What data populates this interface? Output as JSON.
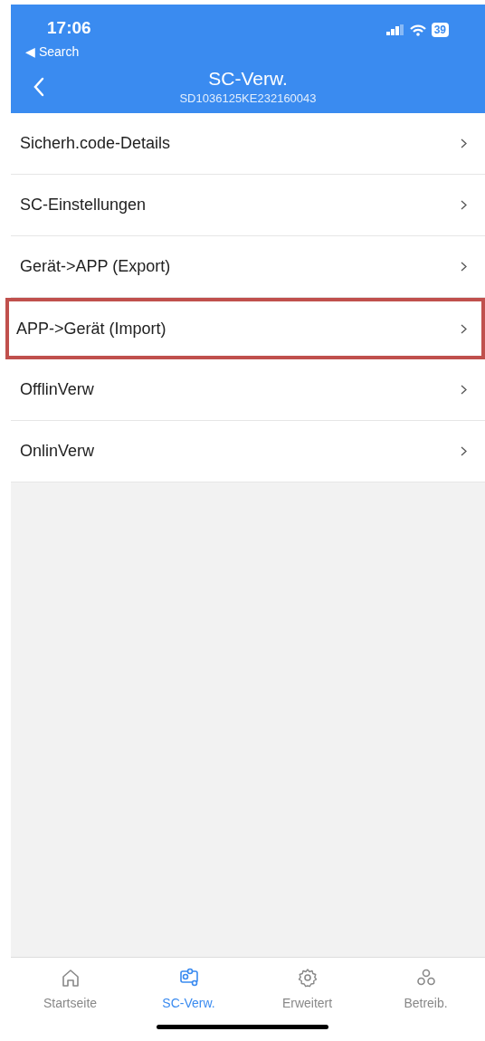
{
  "status_bar": {
    "time": "17:06",
    "back_link": "◀ Search",
    "battery": "39"
  },
  "header": {
    "title": "SC-Verw.",
    "subtitle": "SD1036125KE232160043"
  },
  "menu": [
    {
      "label": "Sicherh.code-Details",
      "highlighted": false
    },
    {
      "label": "SC-Einstellungen",
      "highlighted": false
    },
    {
      "label": "Gerät->APP (Export)",
      "highlighted": false
    },
    {
      "label": "APP->Gerät (Import)",
      "highlighted": true
    },
    {
      "label": "OfflinVerw",
      "highlighted": false
    },
    {
      "label": "OnlinVerw",
      "highlighted": false
    }
  ],
  "tab_bar": [
    {
      "kind": "home",
      "label": "Startseite",
      "selected": false
    },
    {
      "kind": "flow",
      "label": "SC-Verw.",
      "selected": true
    },
    {
      "kind": "gear",
      "label": "Erweitert",
      "selected": false
    },
    {
      "kind": "nodes",
      "label": "Betreib.",
      "selected": false
    }
  ]
}
